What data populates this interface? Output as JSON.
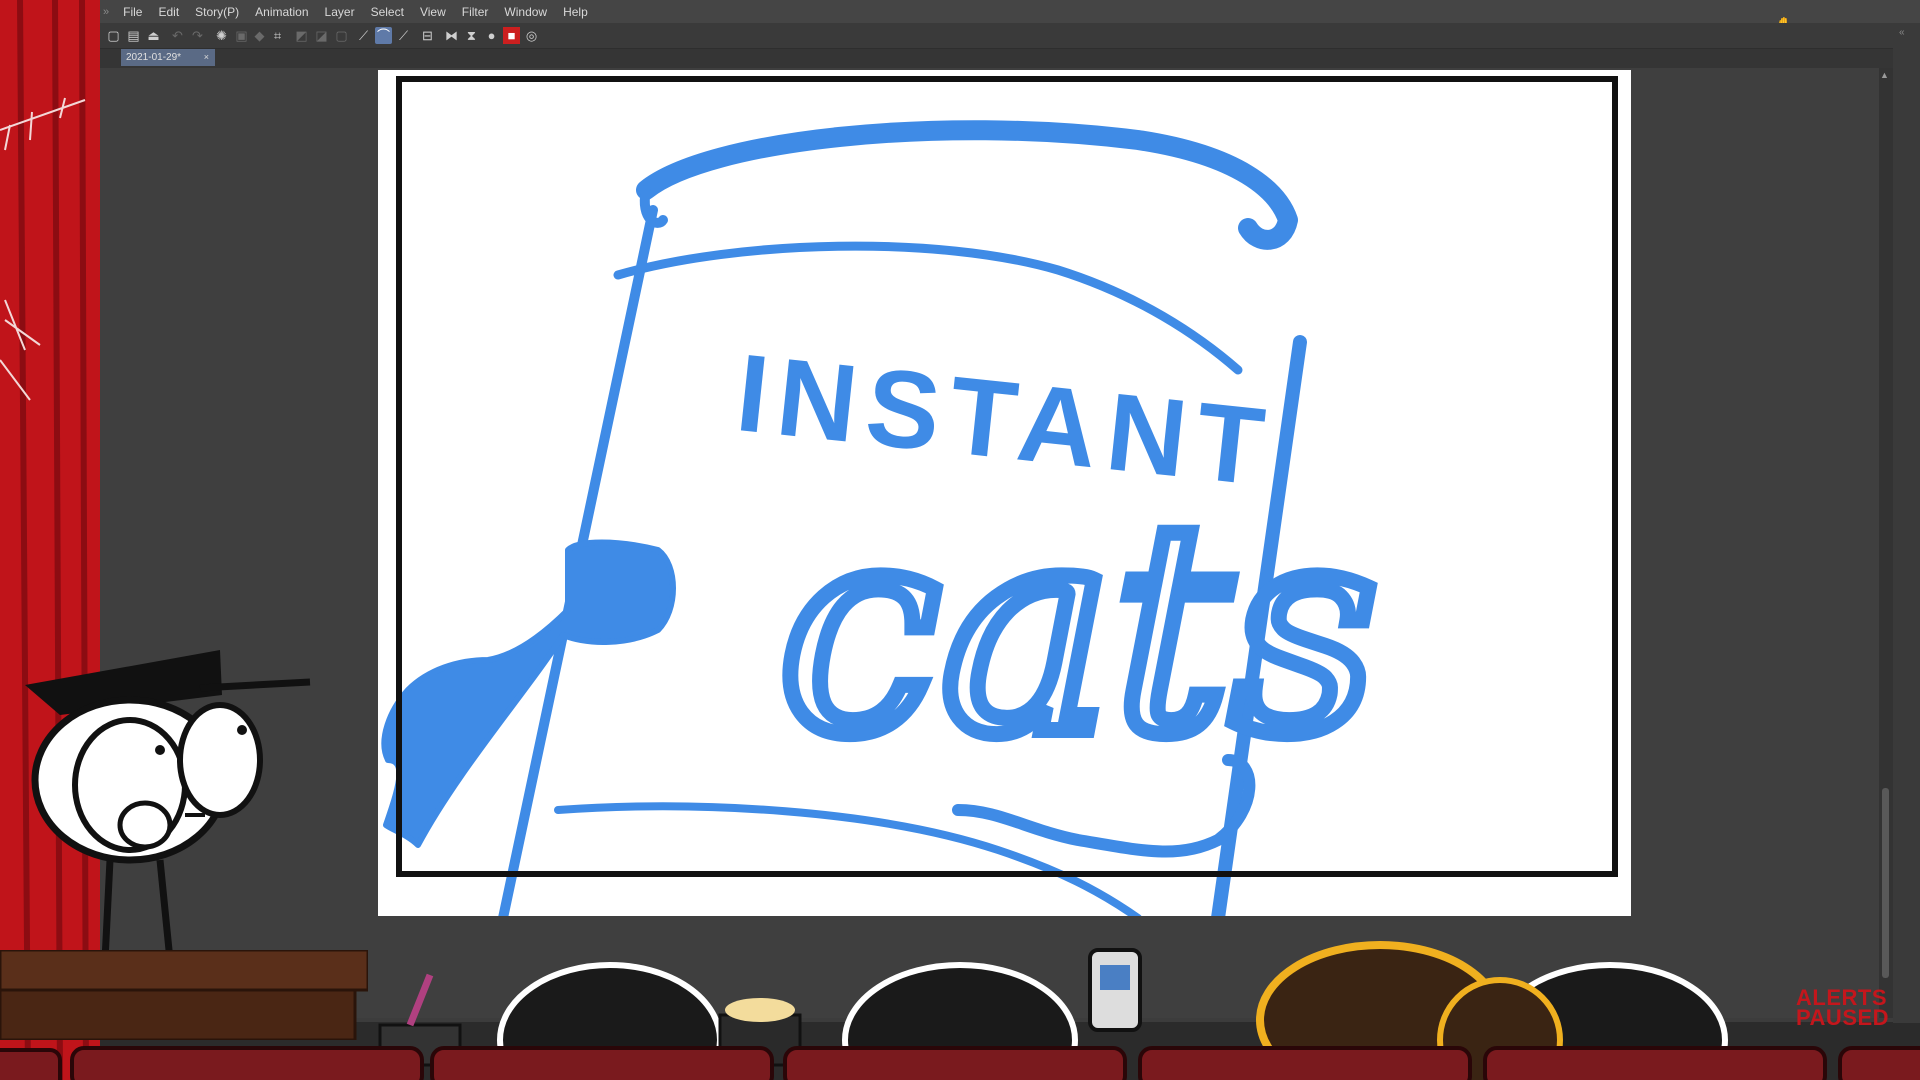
{
  "menu": {
    "items": [
      "File",
      "Edit",
      "Story(P)",
      "Animation",
      "Layer",
      "Select",
      "View",
      "Filter",
      "Window",
      "Help"
    ]
  },
  "toolbar": {
    "icons": [
      "new-file-icon",
      "open-file-icon",
      "save-icon",
      "undo-icon",
      "redo-icon",
      "loading-icon",
      "clear-icon",
      "fill-icon",
      "transform-icon",
      "selection-invert-icon",
      "selection-shrink-icon",
      "deselect-icon",
      "pen-tool-icon",
      "curve-tool-icon",
      "line-tool-icon",
      "frame-icon",
      "flip-horizontal-icon",
      "flip-vertical-icon",
      "color-circle-icon",
      "record-icon",
      "zoom-icon"
    ]
  },
  "document": {
    "tab_label": "2021-01-29*",
    "close_glyph": "×"
  },
  "drawing": {
    "line1": "INSTANT",
    "line2": "cats",
    "ink_color": "#3f8be6"
  },
  "overlay": {
    "alerts_line1": "ALERTS",
    "alerts_line2": "PAUSED"
  },
  "colors": {
    "curtain_red": "#c0141a",
    "seat_red": "#7a1a1e",
    "podium_brown": "#5a2f1a",
    "app_bg": "#3c3c3c",
    "active_tool": "#5f7aa8"
  }
}
